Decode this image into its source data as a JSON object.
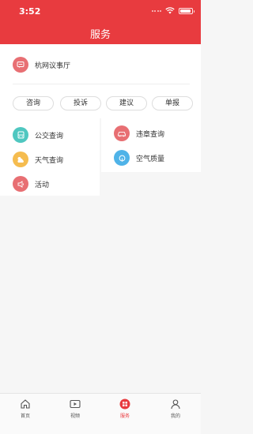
{
  "status_bar": {
    "time": "3:52"
  },
  "header": {
    "title": "服务"
  },
  "hall": {
    "label": "杭网议事厅",
    "icon": "chat-hall-icon"
  },
  "action_pills": [
    {
      "label": "咨询"
    },
    {
      "label": "投诉"
    },
    {
      "label": "建议"
    },
    {
      "label": "单报"
    }
  ],
  "services_left": [
    {
      "label": "公交查询",
      "icon": "bus-icon",
      "color": "#4fc7c0"
    },
    {
      "label": "天气查询",
      "icon": "weather-icon",
      "color": "#f5bc4f"
    },
    {
      "label": "活动",
      "icon": "megaphone-icon",
      "color": "#e86f73"
    }
  ],
  "services_right": [
    {
      "label": "违章查询",
      "icon": "car-icon",
      "color": "#e86f73"
    },
    {
      "label": "空气质量",
      "icon": "air-quality-icon",
      "color": "#4fb3e8"
    }
  ],
  "tabbar": {
    "items": [
      {
        "label": "首页",
        "icon": "home-icon"
      },
      {
        "label": "视频",
        "icon": "video-icon"
      },
      {
        "label": "服务",
        "icon": "services-grid-icon",
        "active": true
      },
      {
        "label": "我的",
        "icon": "profile-icon"
      }
    ],
    "active_color": "#e83b3f"
  },
  "colors": {
    "brand_red": "#e83b3f"
  }
}
